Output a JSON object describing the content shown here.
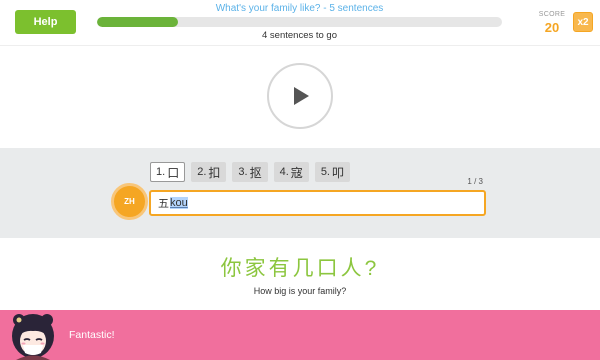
{
  "header": {
    "help_label": "Help",
    "topic_title": "What's your family like? - 5 sentences",
    "progress_fraction": 0.2,
    "remaining_text": "4 sentences to go",
    "score_label": "SCORE",
    "score_value": "20",
    "multiplier": "x2"
  },
  "player": {
    "icon": "play-icon"
  },
  "ime": {
    "candidates": [
      {
        "num": "1.",
        "char": "口",
        "selected": true
      },
      {
        "num": "2.",
        "char": "扣",
        "selected": false
      },
      {
        "num": "3.",
        "char": "抠",
        "selected": false
      },
      {
        "num": "4.",
        "char": "寇",
        "selected": false
      },
      {
        "num": "5.",
        "char": "叩",
        "selected": false
      }
    ],
    "page_indicator": "1 / 3",
    "language_badge": "ZH",
    "typed_text": "五",
    "pending_pinyin": "kou"
  },
  "prompt": {
    "chinese": "你家有几口人?",
    "english": "How big is your family?"
  },
  "feedback": {
    "message": "Fantastic!",
    "avatar_icon": "character-avatar-icon"
  },
  "colors": {
    "accent_green": "#7cc02e",
    "accent_orange": "#f5a623",
    "feedback_pink": "#f16f9d",
    "title_blue": "#5bb2e8"
  }
}
